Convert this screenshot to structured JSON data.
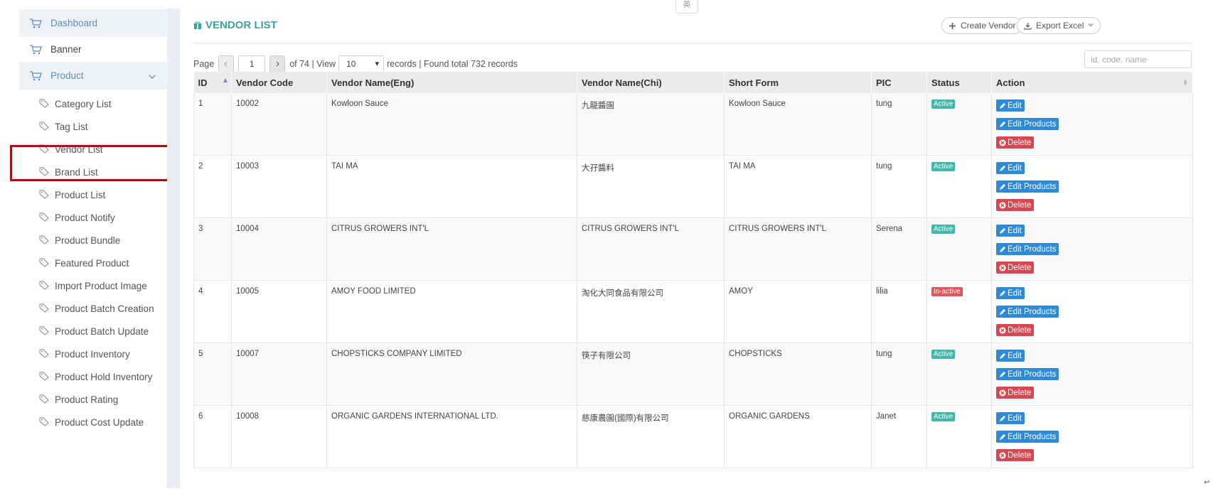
{
  "sidebar": {
    "top_items": [
      {
        "label": "Dashboard",
        "active": true
      },
      {
        "label": "Banner"
      },
      {
        "label": "Product",
        "active": true,
        "expanded": true
      }
    ],
    "sub_items": [
      {
        "label": "Category List"
      },
      {
        "label": "Tag List"
      },
      {
        "label": "Vendor List",
        "selected": true
      },
      {
        "label": "Brand List"
      },
      {
        "label": "Product List"
      },
      {
        "label": "Product Notify"
      },
      {
        "label": "Product Bundle"
      },
      {
        "label": "Featured Product"
      },
      {
        "label": "Import Product Image"
      },
      {
        "label": "Product Batch Creation"
      },
      {
        "label": "Product Batch Update"
      },
      {
        "label": "Product Inventory"
      },
      {
        "label": "Product Hold Inventory"
      },
      {
        "label": "Product Rating"
      },
      {
        "label": "Product Cost Update"
      }
    ],
    "icons": {
      "top": "cart-icon",
      "sub": "tag-icon",
      "expand": "chevron-down-icon"
    }
  },
  "ime_indicator": "英",
  "header": {
    "title": "VENDOR LIST",
    "create_label": "Create Vendor",
    "export_label": "Export Excel"
  },
  "pager": {
    "page_label": "Page",
    "current_page": "1",
    "of_text": "of 74 | View",
    "page_size": "10",
    "records_text": "records | Found total 732 records"
  },
  "search": {
    "placeholder": "id, code, name"
  },
  "table": {
    "columns": [
      "ID",
      "Vendor Code",
      "Vendor Name(Eng)",
      "Vendor Name(Chi)",
      "Short Form",
      "PIC",
      "Status",
      "Action"
    ],
    "rows": [
      {
        "id": "1",
        "code": "10002",
        "name_eng": "Kowloon Sauce",
        "name_chi": "九龍醬園",
        "short": "Kowloon Sauce",
        "pic": "tung",
        "status": "Active"
      },
      {
        "id": "2",
        "code": "10003",
        "name_eng": "TAI MA",
        "name_chi": "大孖醬料",
        "short": "TAI MA",
        "pic": "tung",
        "status": "Active"
      },
      {
        "id": "3",
        "code": "10004",
        "name_eng": "CITRUS GROWERS INT'L",
        "name_chi": "CITRUS GROWERS INT'L",
        "short": "CITRUS GROWERS INT'L",
        "pic": "Serena",
        "status": "Active"
      },
      {
        "id": "4",
        "code": "10005",
        "name_eng": "AMOY FOOD LIMITED",
        "name_chi": "淘化大同食品有限公司",
        "short": "AMOY",
        "pic": "lilia",
        "status": "In-active"
      },
      {
        "id": "5",
        "code": "10007",
        "name_eng": "CHOPSTICKS COMPANY LIMITED",
        "name_chi": "筷子有限公司",
        "short": "CHOPSTICKS",
        "pic": "tung",
        "status": "Active"
      },
      {
        "id": "6",
        "code": "10008",
        "name_eng": "ORGANIC GARDENS INTERNATIONAL LTD.",
        "name_chi": "慈康農園(國際)有限公司",
        "short": "ORGANIC GARDENS",
        "pic": "Janet",
        "status": "Active"
      }
    ],
    "actions": {
      "edit": "Edit",
      "edit_products": "Edit Products",
      "delete": "Delete"
    }
  },
  "colors": {
    "accent": "#3aa5a0",
    "link_blue": "#5b8ec6",
    "btn_blue": "#2f8ad6",
    "btn_red": "#d6474f",
    "status_active": "#3fb8a8",
    "status_inactive": "#e0565a",
    "highlight": "#a0141c"
  }
}
